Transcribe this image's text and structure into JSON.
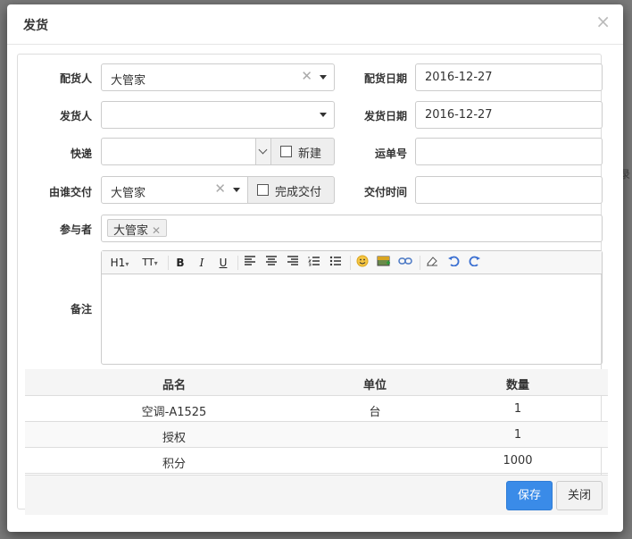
{
  "modal": {
    "title": "发货",
    "close_icon": "×"
  },
  "labels": {
    "distributor": "配货人",
    "distribute_date": "配货日期",
    "shipper": "发货人",
    "ship_date": "发货日期",
    "express": "快递",
    "tracking_no": "运单号",
    "delivered_by": "由谁交付",
    "delivery_time": "交付时间",
    "participants": "参与者",
    "notes": "备注"
  },
  "fields": {
    "distributor_value": "大管家",
    "distribute_date_value": "2016-12-27",
    "shipper_value": "",
    "ship_date_value": "2016-12-27",
    "express_value": "",
    "new_label": "新建",
    "tracking_no_value": "",
    "delivered_by_value": "大管家",
    "complete_delivery_label": "完成交付",
    "delivery_time_value": "",
    "participant_tag": "大管家"
  },
  "toolbar": {
    "h1": "H1",
    "font_size": "TT",
    "bold": "B",
    "italic": "I",
    "underline": "U"
  },
  "table": {
    "headers": {
      "name": "品名",
      "unit": "单位",
      "qty": "数量"
    },
    "rows": [
      {
        "name": "空调-A1525",
        "unit": "台",
        "qty": "1"
      },
      {
        "name": "授权",
        "unit": "",
        "qty": "1"
      },
      {
        "name": "积分",
        "unit": "",
        "qty": "1000"
      }
    ]
  },
  "buttons": {
    "save": "保存",
    "close": "关闭"
  },
  "background": {
    "partial_text": "录"
  },
  "colors": {
    "primary": "#3a8be8",
    "header_bg": "#f5f5f5"
  }
}
